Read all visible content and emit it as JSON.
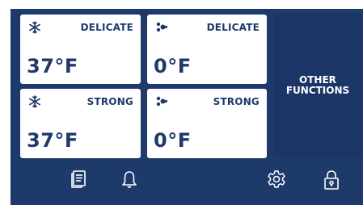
{
  "tiles": [
    {
      "icon": "snowflake-icon",
      "mode": "DELICATE",
      "temperature": "37°F"
    },
    {
      "icon": "fan-icon",
      "mode": "DELICATE",
      "temperature": "0°F"
    },
    {
      "icon": "snowflake-icon",
      "mode": "STRONG",
      "temperature": "37°F"
    },
    {
      "icon": "fan-icon",
      "mode": "STRONG",
      "temperature": "0°F"
    }
  ],
  "other_functions": {
    "label_line1": "OTHER",
    "label_line2": "FUNCTIONS"
  },
  "bottom_bar": {
    "icons": [
      "document-icon",
      "bell-icon",
      "gear-icon",
      "lock-icon"
    ]
  },
  "colors": {
    "primary": "#1e3a6b",
    "tile": "#ffffff"
  }
}
